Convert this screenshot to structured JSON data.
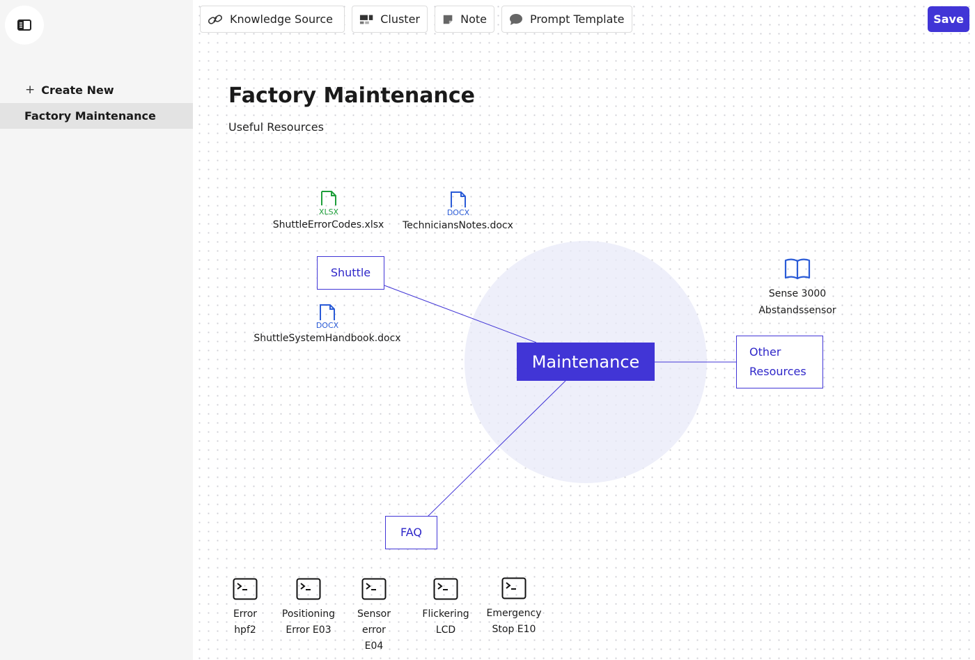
{
  "toolbar": {
    "knowledge_source": "Knowledge Source",
    "cluster": "Cluster",
    "note": "Note",
    "prompt_template": "Prompt Template",
    "save": "Save"
  },
  "sidebar": {
    "create_new": "Create New",
    "items": [
      {
        "label": "Factory Maintenance",
        "active": true
      }
    ]
  },
  "canvas": {
    "title": "Factory Maintenance",
    "subtitle": "Useful Resources",
    "clusters": {
      "maintenance": "Maintenance",
      "shuttle": "Shuttle",
      "other_resources": "Other Resources",
      "faq": "FAQ"
    },
    "files": [
      {
        "name": "ShuttleErrorCodes.xlsx",
        "type": "XLSX",
        "color": "#1e9e3a"
      },
      {
        "name": "TechniciansNotes.docx",
        "type": "DOCX",
        "color": "#2a5bd7"
      },
      {
        "name": "ShuttleSystemHandbook.docx",
        "type": "DOCX",
        "color": "#2a5bd7"
      }
    ],
    "book": {
      "label_line1": "Sense 3000",
      "label_line2": "Abstandssensor",
      "icon": "book-icon"
    },
    "prompts": [
      {
        "label": "Error\nhpf2"
      },
      {
        "label": "Positioning\nError E03"
      },
      {
        "label": "Sensor\nerror\nE04"
      },
      {
        "label": "Flickering\nLCD"
      },
      {
        "label": "Emergency\nStop E10"
      }
    ]
  },
  "colors": {
    "accent": "#4135d6",
    "sidebar_bg": "#f5f5f5",
    "cluster_bg": "#e8eaf8"
  }
}
